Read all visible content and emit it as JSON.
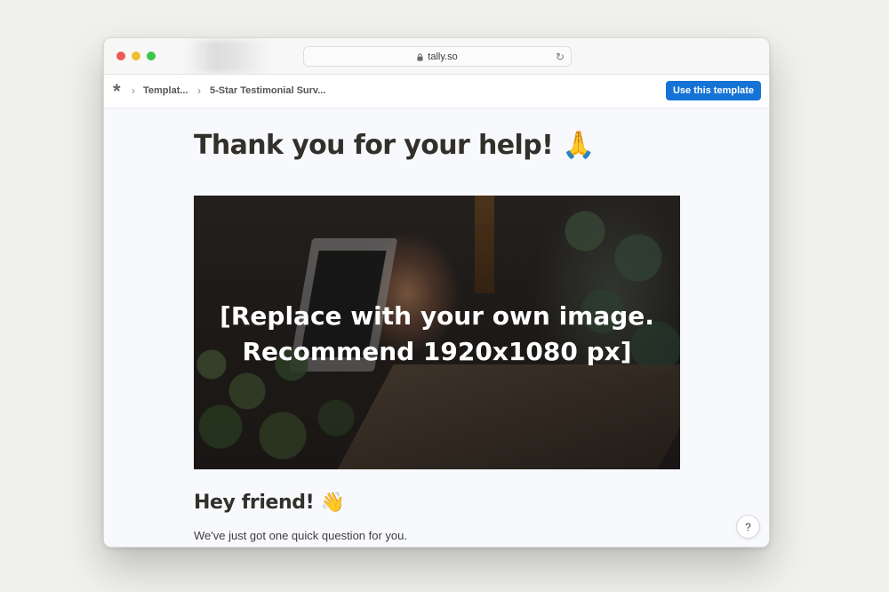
{
  "browser": {
    "url": "tally.so"
  },
  "navbar": {
    "breadcrumbs": [
      "Templat...",
      "5-Star Testimonial Surv..."
    ],
    "use_template_label": "Use this template"
  },
  "page": {
    "title": "Thank you for your help! 🙏",
    "hero_text_line1": "[Replace with your own image.",
    "hero_text_line2": "Recommend 1920x1080 px]",
    "section_title": "Hey friend! 👋",
    "section_text": "We've just got one quick question for you."
  },
  "help_label": "?",
  "colors": {
    "accent": "#1573d6",
    "title_text": "#33302b",
    "page_background": "#f8f9fc",
    "desktop_background": "#f0f0ec"
  },
  "icons": {
    "window_controls": [
      "close-dot",
      "minimize-dot",
      "zoom-dot"
    ],
    "url_lock": "lock-icon",
    "url_reload": "reload-icon",
    "logo": "tally-asterisk-logo",
    "breadcrumb_separator": "chevron-right-icon"
  }
}
